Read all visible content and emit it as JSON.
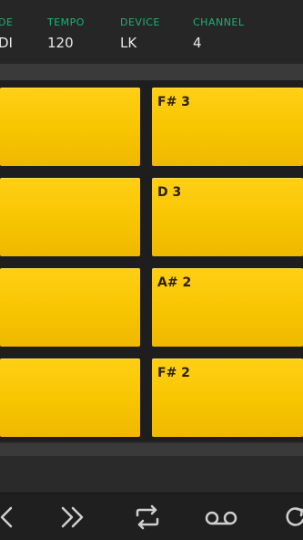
{
  "header": {
    "mode_label": "DE",
    "mode_value": "DI",
    "tempo_label": "TEMPO",
    "tempo_value": "120",
    "device_label": "DEVICE",
    "device_value": "LK",
    "channel_label": "CHANNEL",
    "channel_value": "4"
  },
  "pads": [
    {
      "label": ""
    },
    {
      "label": "F# 3"
    },
    {
      "label": ""
    },
    {
      "label": "D 3"
    },
    {
      "label": ""
    },
    {
      "label": "A# 2"
    },
    {
      "label": ""
    },
    {
      "label": "F# 2"
    }
  ],
  "toolbar": {
    "icons": [
      "chevron-left-icon",
      "double-chevron-right-icon",
      "repeat-icon",
      "voicemail-icon",
      "refresh-icon"
    ]
  },
  "colors": {
    "accent_label": "#19b37a",
    "pad": "#f7c500",
    "background": "#2b2b2b"
  }
}
